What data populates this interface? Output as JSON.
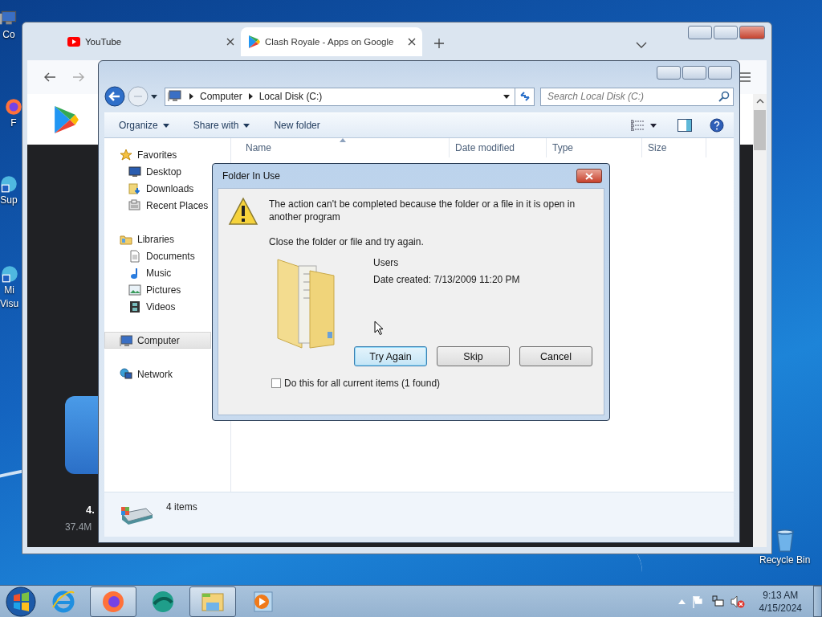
{
  "desktop_icons": [
    {
      "kind": "computer",
      "lines": [
        "Co"
      ]
    },
    {
      "kind": "firefox",
      "lines": [
        "F"
      ]
    },
    {
      "kind": "app",
      "lines": [
        "Sup"
      ]
    },
    {
      "kind": "app",
      "lines": [
        "Mi",
        "Visu"
      ]
    },
    {
      "kind": "recycle",
      "lines": [
        "Recycle Bin"
      ]
    }
  ],
  "browser": {
    "tabs": [
      {
        "kind": "youtube",
        "title": "YouTube",
        "selected": false
      },
      {
        "kind": "play",
        "title": "Clash Royale - Apps on Google",
        "selected": true
      }
    ],
    "page": {
      "rating": "4.",
      "size": "37.4M"
    }
  },
  "explorer": {
    "breadcrumb": [
      "Computer",
      "Local Disk (C:)"
    ],
    "search": {
      "placeholder": "Search Local Disk (C:)"
    },
    "toolbar": [
      {
        "label": "Organize",
        "menu": true
      },
      {
        "label": "Share with",
        "menu": true
      },
      {
        "label": "New folder",
        "menu": false
      }
    ],
    "nav": [
      {
        "kind": "favorites",
        "label": "Favorites",
        "selected": false,
        "children": [
          {
            "kind": "desktop",
            "label": "Desktop",
            "selected": false
          },
          {
            "kind": "downloads",
            "label": "Downloads",
            "selected": false
          },
          {
            "kind": "recent",
            "label": "Recent Places",
            "selected": false
          }
        ]
      },
      {
        "kind": "libraries",
        "label": "Libraries",
        "selected": false,
        "children": [
          {
            "kind": "documents",
            "label": "Documents",
            "selected": false
          },
          {
            "kind": "music",
            "label": "Music",
            "selected": false
          },
          {
            "kind": "pictures",
            "label": "Pictures",
            "selected": false
          },
          {
            "kind": "videos",
            "label": "Videos",
            "selected": false
          }
        ]
      },
      {
        "kind": "computer",
        "label": "Computer",
        "selected": true
      },
      {
        "kind": "network",
        "label": "Network",
        "selected": false
      }
    ],
    "columns": [
      {
        "label": "Name",
        "sorted": true
      },
      {
        "label": "Date modified",
        "sorted": false
      },
      {
        "label": "Type",
        "sorted": false
      },
      {
        "label": "Size",
        "sorted": false
      }
    ],
    "status": "4 items"
  },
  "dialog": {
    "title": "Folder In Use",
    "message": "The action can't be completed because the folder or a file in it is open in another program",
    "hint": "Close the folder or file and try again.",
    "item": {
      "name": "Users",
      "detail": "Date created: 7/13/2009 11:20 PM"
    },
    "buttons": [
      {
        "label": "Try Again",
        "default": true
      },
      {
        "label": "Skip",
        "default": false
      },
      {
        "label": "Cancel",
        "default": false
      }
    ],
    "checkbox": {
      "label": "Do this for all current items (1 found)",
      "checked": false
    }
  },
  "taskbar": {
    "apps": [
      {
        "kind": "ie",
        "open": false
      },
      {
        "kind": "firefox",
        "open": true
      },
      {
        "kind": "globe",
        "open": false
      },
      {
        "kind": "explorer",
        "open": true
      },
      {
        "kind": "media",
        "open": false
      }
    ],
    "clock": {
      "time": "9:13 AM",
      "date": "4/15/2024"
    }
  }
}
